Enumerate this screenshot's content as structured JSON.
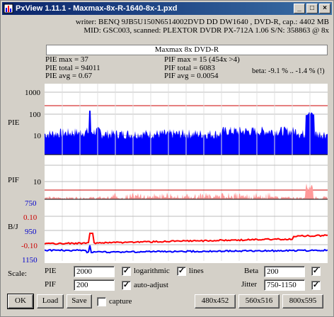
{
  "window": {
    "title": "PxView 1.11.1  -  Maxmax-8x-R-1640-8x-1.pxd",
    "controls": [
      "_",
      "□",
      "×"
    ]
  },
  "header": {
    "line1": "writer: BENQ 9JB5U150N6514002DVD DD DW1640 , DVD-R, cap.: 4402 MB",
    "line2": "MID: GSC003, scanned: PLEXTOR DVDR PX-712A 1.06 S/N: 358863 @ 8x",
    "disc": "Maxmax 8x DVD-R"
  },
  "stats": {
    "pie_max": "PIE max = 37",
    "pie_total": "PIE total = 94011",
    "pie_avg": "PIE avg = 0.67",
    "pif_max": "PIF max = 15 (454x >4)",
    "pif_total": "PIF total = 6083",
    "pif_avg": "PIF avg = 0.0054",
    "beta": "beta: -9.1 % .. -1.4 % (!)"
  },
  "chart_data": [
    {
      "type": "area",
      "label": "PIE",
      "y_scale": "log",
      "ticks": [
        "1000",
        "100",
        "10"
      ],
      "threshold": 280,
      "colors": {
        "fill": "#0000ff",
        "threshold": "#cc0000"
      }
    },
    {
      "type": "area",
      "label": "PIF",
      "ticks": [
        "10"
      ],
      "threshold": 4,
      "colors": {
        "fill": "#ff9999",
        "threshold": "#cc0000"
      }
    },
    {
      "type": "line",
      "label": "B/J",
      "ticks_left": [
        "750",
        "0.10",
        "950",
        "-0.10",
        "1150"
      ],
      "series": [
        {
          "name": "beta",
          "color": "#ff0000"
        },
        {
          "name": "jitter",
          "color": "#0000ff"
        }
      ]
    }
  ],
  "scale": {
    "label": "Scale:",
    "pie_label": "PIE",
    "pie_value": "2000",
    "pif_label": "PIF",
    "pif_value": "200",
    "logarithmic": "logarithmic",
    "lines": "lines",
    "auto_adjust": "auto-adjust",
    "beta_label": "Beta",
    "beta_value": "200",
    "jitter_label": "Jitter",
    "jitter_value": "750-1150",
    "check": "✓"
  },
  "buttons": {
    "ok": "OK",
    "load": "Load",
    "save": "Save",
    "capture": "capture",
    "size1": "480x452",
    "size2": "560x516",
    "size3": "800x595"
  }
}
